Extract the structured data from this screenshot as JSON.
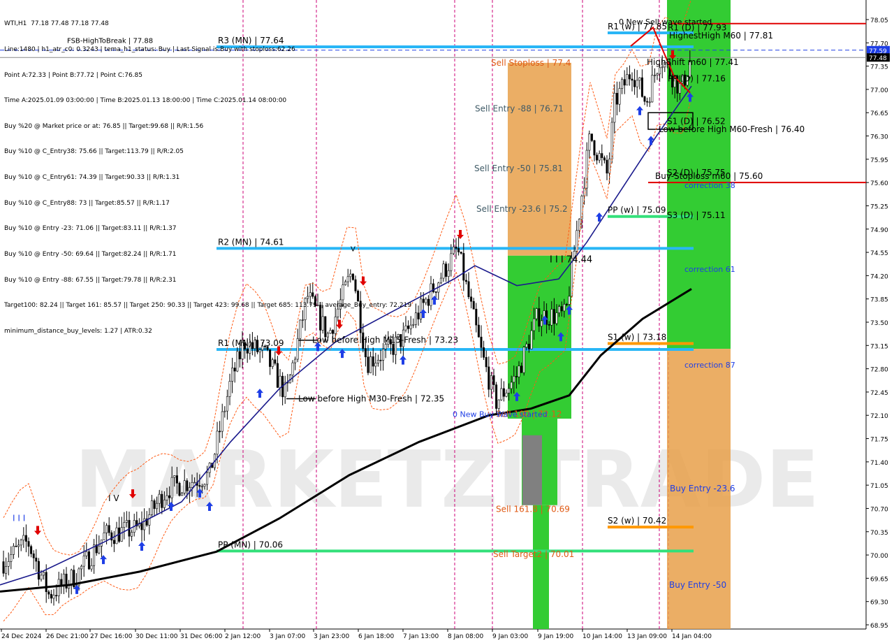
{
  "chart_data": {
    "type": "candlestick",
    "symbol_timeframe": "WTI,H1",
    "ohlc_readout": "77.18 77.48 77.18 77.48",
    "watermark": "MARKETZITRADE",
    "info_lines": [
      "Line:1480 | h1_atr_c0: 0.3243 | tema_h1_status: Buy | Last Signal is:Buy with stoploss:62.26",
      "Point A:72.33 | Point B:77.72 | Point C:76.85",
      "Time A:2025.01.09 03:00:00 | Time B:2025.01.13 18:00:00 | Time C:2025.01.14 08:00:00",
      "Buy %20 @ Market price or at: 76.85 || Target:99.68 || R/R:1.56",
      "Buy %10 @ C_Entry38: 75.66 || Target:113.79 || R/R:2.05",
      "Buy %10 @ C_Entry61: 74.39 || Target:90.33 || R/R:1.31",
      "Buy %10 @ C_Entry88: 73 || Target:85.57 || R/R:1.17",
      "Buy %10 @ Entry -23: 71.06 || Target:83.11 || R/R:1.37",
      "Buy %10 @ Entry -50: 69.64 || Target:82.24 || R/R:1.71",
      "Buy %10 @ Entry -88: 67.55 || Target:79.78 || R/R:2.31",
      "Target100: 82.24 || Target 161: 85.57 || Target 250: 90.33 || Target 423: 99.68 || Target 685: 113.79 || average_Buy_entry: 72.219",
      "minimum_distance_buy_levels: 1.27 | ATR:0.32"
    ],
    "y_axis": {
      "min": 68.95,
      "max": 78.05,
      "ticks": [
        "78.05",
        "77.70",
        "77.35",
        "77.00",
        "76.65",
        "76.30",
        "75.95",
        "75.60",
        "75.25",
        "74.90",
        "74.55",
        "74.20",
        "73.85",
        "73.50",
        "73.15",
        "72.80",
        "72.45",
        "72.10",
        "71.75",
        "71.40",
        "71.05",
        "70.70",
        "70.35",
        "70.00",
        "69.65",
        "69.30",
        "68.95"
      ]
    },
    "x_axis": {
      "ticks": [
        "24 Dec 2024",
        "26 Dec 21:00",
        "27 Dec 16:00",
        "30 Dec 11:00",
        "31 Dec 06:00",
        "2 Jan 12:00",
        "3 Jan 07:00",
        "3 Jan 23:00",
        "6 Jan 18:00",
        "7 Jan 13:00",
        "8 Jan 08:00",
        "9 Jan 03:00",
        "9 Jan 19:00",
        "10 Jan 14:00",
        "13 Jan 09:00",
        "14 Jan 04:00"
      ]
    },
    "price_badges": [
      {
        "value": "77.59",
        "color": "#1e3ee6"
      },
      {
        "value": "77.48",
        "color": "#000000"
      }
    ],
    "levels": [
      {
        "label": "R3 (MN) | 77.64",
        "price": 77.64,
        "color": "#29b6f6"
      },
      {
        "label": "R2 (MN) | 74.61",
        "price": 74.61,
        "color": "#29b6f6"
      },
      {
        "label": "R1 (MN) | 73.09",
        "price": 73.09,
        "color": "#29b6f6"
      },
      {
        "label": "PP (MN) | 70.06",
        "price": 70.06,
        "color": "#33e07a"
      },
      {
        "label": "R1 (w) | 77.85",
        "price": 77.85,
        "color": "#29b6f6"
      },
      {
        "label": "PP (w) | 75.09",
        "price": 75.09,
        "color": "#33e07a"
      },
      {
        "label": "S1 (w) | 73.18",
        "price": 73.18,
        "color": "#ff9800"
      },
      {
        "label": "S2 (w) | 70.42",
        "price": 70.42,
        "color": "#ff9800"
      },
      {
        "label": "Buy-Stoploss m60 | 75.60",
        "price": 75.6,
        "color": "#e00000"
      },
      {
        "label": "HighShift m60 | 77.41",
        "price": 77.41,
        "color": "#000000"
      },
      {
        "label": "Low before High   M60-Fresh | 76.40",
        "price": 76.4,
        "color": "#000000"
      },
      {
        "label": "Low before High   M15-Fresh | 73.23",
        "price": 73.23,
        "color": "#000000"
      },
      {
        "label": "Low before High   M30-Fresh | 72.35",
        "price": 72.35,
        "color": "#000000"
      }
    ],
    "labels": [
      {
        "text": "Sell Stoploss | 77.4",
        "color": "#e05a14"
      },
      {
        "text": "Sell Entry -88 | 76.71",
        "color": "#3f5a66"
      },
      {
        "text": "Sell Entry -50 | 75.81",
        "color": "#3f5a66"
      },
      {
        "text": "Sell Entry -23.6 | 75.2",
        "color": "#3f5a66"
      },
      {
        "text": "I I I 74.44",
        "color": "#000000"
      },
      {
        "text": "Sell 100 | 72.12",
        "color": "#e05a14"
      },
      {
        "text": "Sell 161.8 | 70.69",
        "color": "#e05a14"
      },
      {
        "text": "Sell Target2 | 70.01",
        "color": "#e05a14"
      },
      {
        "text": "0 New Buy Wave started",
        "color": "#1e3ee6"
      },
      {
        "text": "0 New Sell wave started",
        "color": "#000000"
      },
      {
        "text": "R1 (D) | 77.93",
        "color": "#000000"
      },
      {
        "text": "HighestHigh   M60 | 77.81",
        "color": "#000000"
      },
      {
        "text": "PP (D) | 77.16",
        "color": "#000000"
      },
      {
        "text": "S1 (D) | 76.52",
        "color": "#000000"
      },
      {
        "text": "S2 (D) | 75.75",
        "color": "#000000"
      },
      {
        "text": "S3 (D) | 75.11",
        "color": "#000000"
      },
      {
        "text": "correction 38",
        "color": "#1e3ee6"
      },
      {
        "text": "correction 61",
        "color": "#1e3ee6"
      },
      {
        "text": "correction 87",
        "color": "#1e3ee6"
      },
      {
        "text": "Buy Entry -23.6",
        "color": "#1e3ee6"
      },
      {
        "text": "Buy Entry -50",
        "color": "#1e3ee6"
      },
      {
        "text": "FSB-HighToBreak | 77.88",
        "color": "#000000"
      },
      {
        "text": "I V",
        "color": "#000000"
      },
      {
        "text": "V",
        "color": "#000000"
      },
      {
        "text": "I I I",
        "color": "#1e3ee6"
      }
    ],
    "colors": {
      "level_blue": "#29b6f6",
      "level_green": "#33e07a",
      "orange": "#ff9800",
      "stop_red": "#e00000",
      "zone_orange": "#e8a04a",
      "zone_green": "#33cc33",
      "magenta_dash": "#cc0077",
      "ma_slow": "#000000",
      "ma_fast": "#1a1a8c",
      "channel": "#ff5a14",
      "arrow_buy": "#1e3ee6",
      "arrow_sell": "#e00000"
    }
  }
}
